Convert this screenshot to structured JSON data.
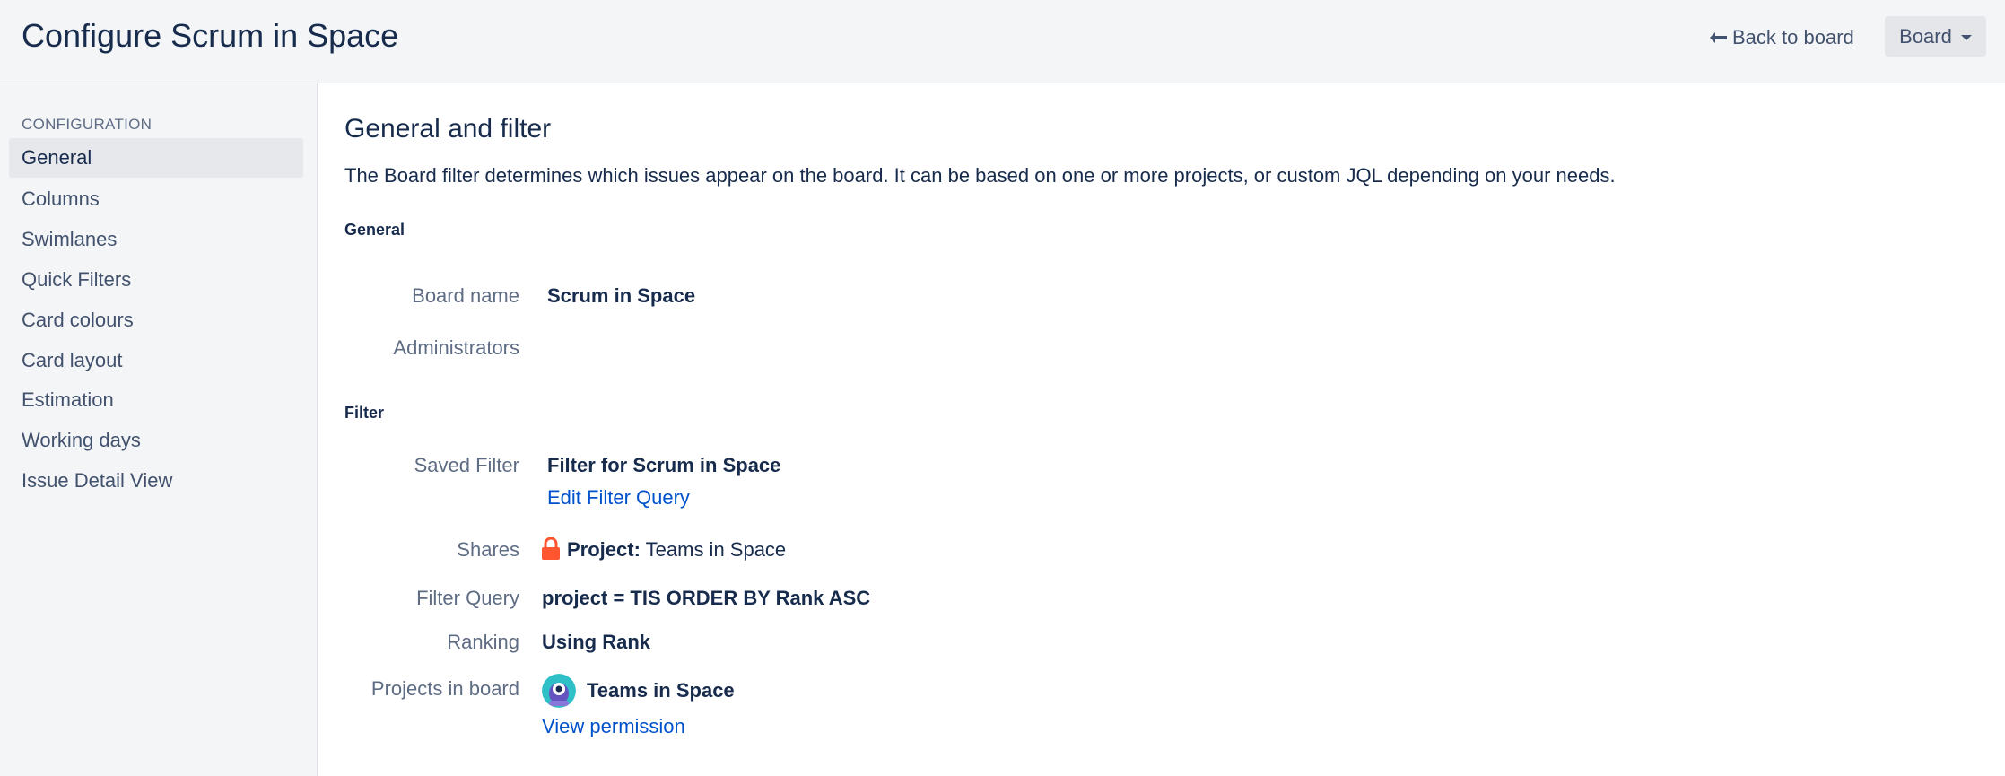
{
  "header": {
    "title": "Configure Scrum in Space",
    "back_link": "Back to board",
    "board_button": "Board"
  },
  "sidebar": {
    "heading": "CONFIGURATION",
    "items": [
      {
        "label": "General",
        "active": true
      },
      {
        "label": "Columns"
      },
      {
        "label": "Swimlanes"
      },
      {
        "label": "Quick Filters"
      },
      {
        "label": "Card colours"
      },
      {
        "label": "Card layout"
      },
      {
        "label": "Estimation"
      },
      {
        "label": "Working days"
      },
      {
        "label": "Issue Detail View"
      }
    ]
  },
  "main": {
    "title": "General and filter",
    "description": "The Board filter determines which issues appear on the board. It can be based on one or more projects, or custom JQL depending on your needs.",
    "general": {
      "heading": "General",
      "board_name_label": "Board name",
      "board_name_value": "Scrum in Space",
      "administrators_label": "Administrators"
    },
    "filter": {
      "heading": "Filter",
      "saved_filter_label": "Saved Filter",
      "saved_filter_value": "Filter for Scrum in Space",
      "edit_filter_link": "Edit Filter Query",
      "shares_label": "Shares",
      "shares_prefix": "Project:",
      "shares_value": "Teams in Space",
      "filter_query_label": "Filter Query",
      "filter_query_value": "project = TIS ORDER BY Rank ASC",
      "ranking_label": "Ranking",
      "ranking_value": "Using Rank",
      "projects_label": "Projects in board",
      "project_name": "Teams in Space",
      "view_permission_link": "View permission"
    }
  },
  "icons": {
    "back": "arrow-left-icon",
    "lock": "lock-icon",
    "project_avatar": "project-avatar-icon"
  },
  "colors": {
    "link": "#0052cc",
    "lock": "#ff5630",
    "avatar": "#2ebfc7"
  }
}
